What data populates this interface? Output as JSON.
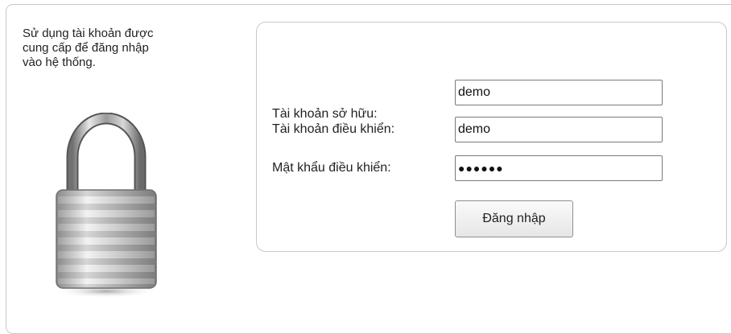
{
  "intro": {
    "line1": "Sử dụng tài khoản được",
    "line2": "cung cấp để đăng nhập",
    "line3": "vào hệ thống."
  },
  "icons": {
    "lock": "padlock-icon"
  },
  "form": {
    "owner_account": {
      "label": "Tài khoản sở hữu:",
      "value": "demo"
    },
    "control_account": {
      "label": "Tài khoản điều khiển:",
      "value": "demo"
    },
    "control_password": {
      "label": "Mật khẩu điều khiển:",
      "value": "●●●●●●"
    },
    "submit_label": "Đăng nhập"
  },
  "colors": {
    "border": "#c8c8c8",
    "text": "#222222",
    "input_border": "#7a7a7a"
  }
}
